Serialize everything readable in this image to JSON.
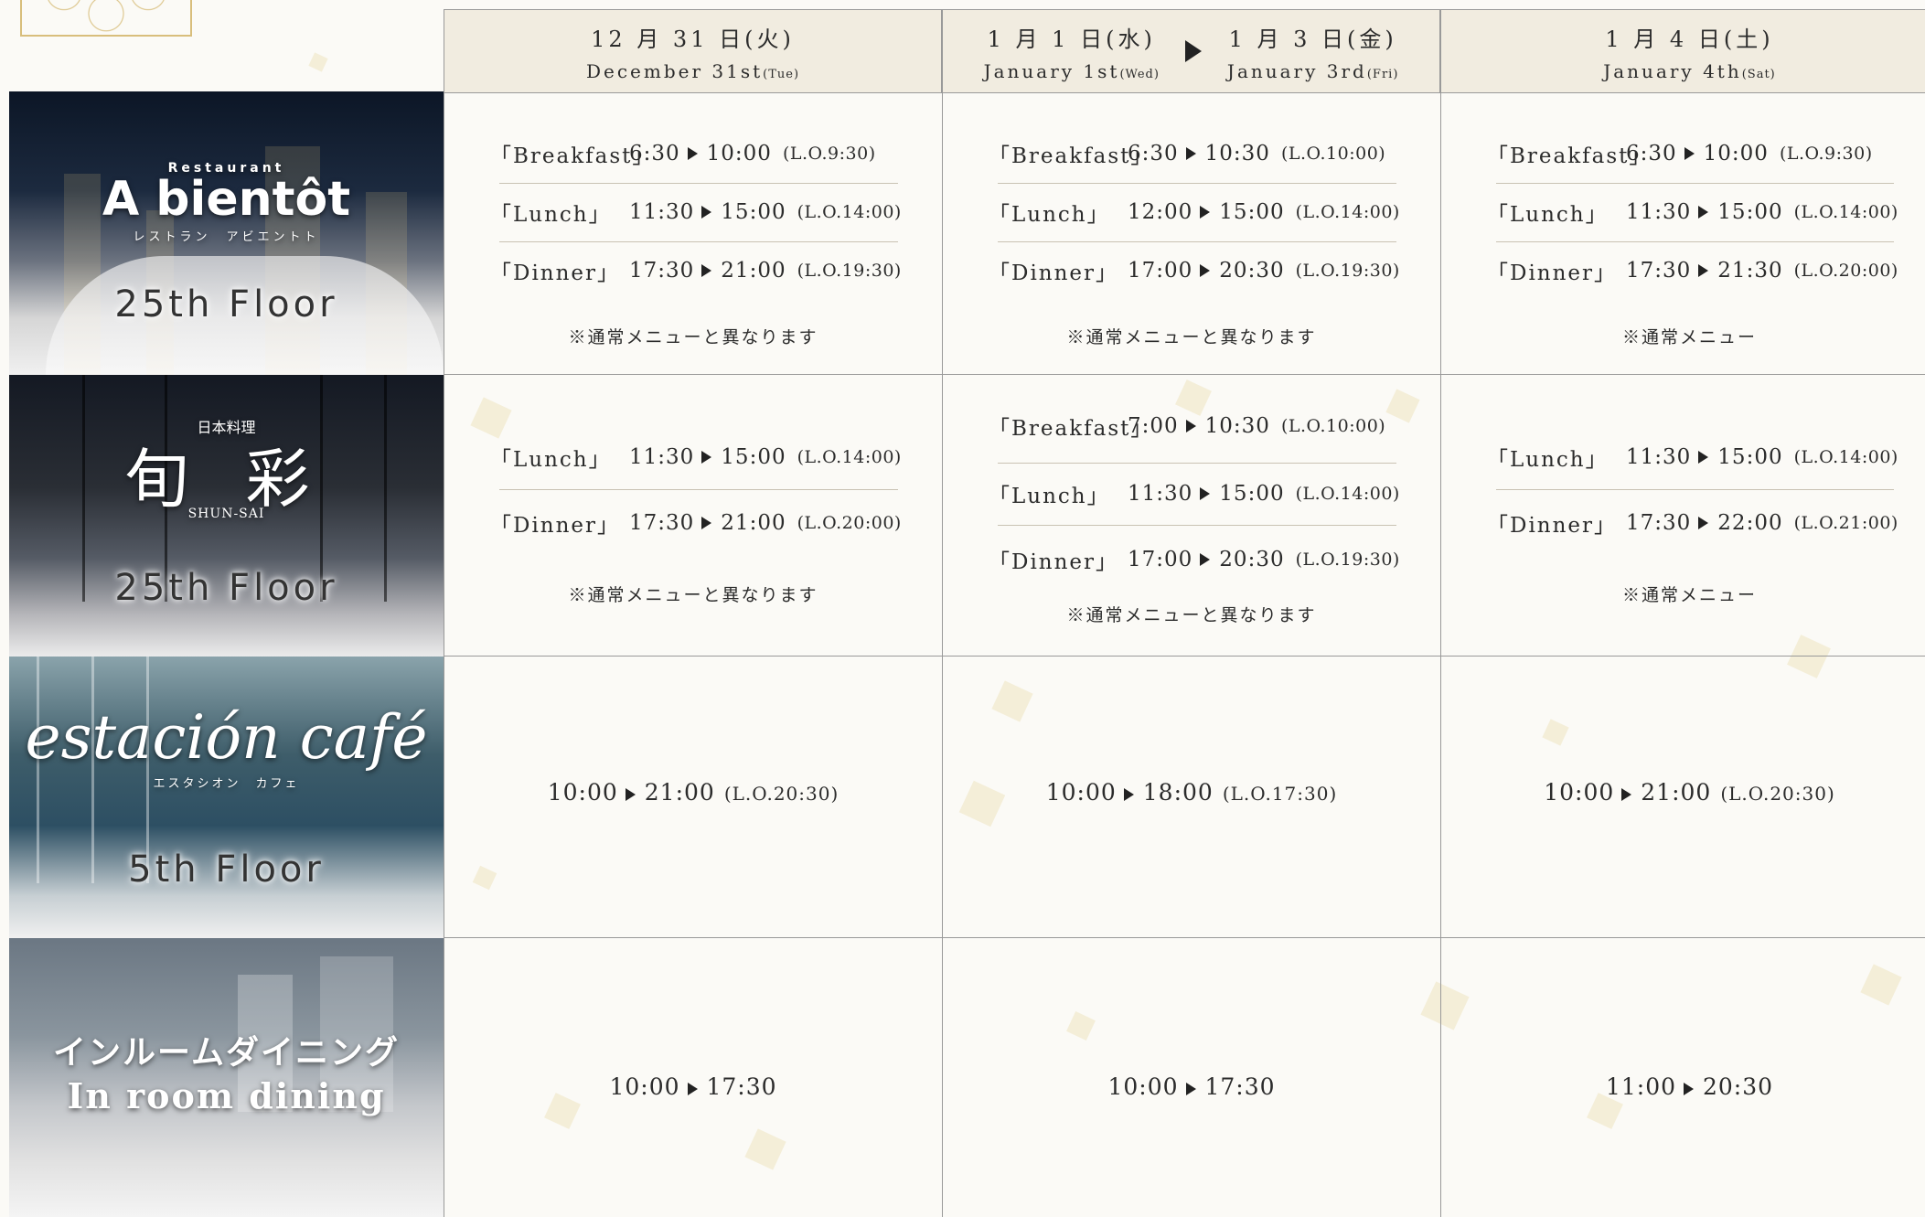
{
  "columns": [
    {
      "jp": "12 月 31 日",
      "jp_day": "(火)",
      "en": "December 31st",
      "en_day": "(Tue)"
    },
    {
      "jp_from": "1 月 1 日",
      "jp_from_day": "(水)",
      "en_from": "January 1st",
      "en_from_day": "(Wed)",
      "jp_to": "1 月 3 日",
      "jp_to_day": "(金)",
      "en_to": "January 3rd",
      "en_to_day": "(Fri)"
    },
    {
      "jp": "1 月 4 日",
      "jp_day": "(土)",
      "en": "January 4th",
      "en_day": "(Sat)"
    }
  ],
  "restaurants": [
    {
      "logo_small": "Restaurant",
      "logo": "A bientôt",
      "logo_kana": "レストラン　アビエントト",
      "floor": "25th Floor",
      "cells": [
        {
          "meals": [
            {
              "name": "「Breakfast」",
              "start": "6:30",
              "end": "10:00",
              "lo": "(L.O.9:30)"
            },
            {
              "name": "「Lunch」",
              "start": "11:30",
              "end": "15:00",
              "lo": "(L.O.14:00)"
            },
            {
              "name": "「Dinner」",
              "start": "17:30",
              "end": "21:00",
              "lo": "(L.O.19:30)"
            }
          ],
          "note": "※通常メニューと異なります"
        },
        {
          "meals": [
            {
              "name": "「Breakfast」",
              "start": "6:30",
              "end": "10:30",
              "lo": "(L.O.10:00)"
            },
            {
              "name": "「Lunch」",
              "start": "12:00",
              "end": "15:00",
              "lo": "(L.O.14:00)"
            },
            {
              "name": "「Dinner」",
              "start": "17:00",
              "end": "20:30",
              "lo": "(L.O.19:30)"
            }
          ],
          "note": "※通常メニューと異なります"
        },
        {
          "meals": [
            {
              "name": "「Breakfast」",
              "start": "6:30",
              "end": "10:00",
              "lo": "(L.O.9:30)"
            },
            {
              "name": "「Lunch」",
              "start": "11:30",
              "end": "15:00",
              "lo": "(L.O.14:00)"
            },
            {
              "name": "「Dinner」",
              "start": "17:30",
              "end": "21:30",
              "lo": "(L.O.20:00)"
            }
          ],
          "note": "※通常メニュー"
        }
      ]
    },
    {
      "logo_small": "日本料理",
      "logo": "旬 彩",
      "logo_kana": "SHUN-SAI",
      "floor": "25th Floor",
      "cells": [
        {
          "meals": [
            {
              "name": "「Lunch」",
              "start": "11:30",
              "end": "15:00",
              "lo": "(L.O.14:00)"
            },
            {
              "name": "「Dinner」",
              "start": "17:30",
              "end": "21:00",
              "lo": "(L.O.20:00)"
            }
          ],
          "note": "※通常メニューと異なります"
        },
        {
          "meals": [
            {
              "name": "「Breakfast」",
              "start": "7:00",
              "end": "10:30",
              "lo": "(L.O.10:00)"
            },
            {
              "name": "「Lunch」",
              "start": "11:30",
              "end": "15:00",
              "lo": "(L.O.14:00)"
            },
            {
              "name": "「Dinner」",
              "start": "17:00",
              "end": "20:30",
              "lo": "(L.O.19:30)"
            }
          ],
          "note": "※通常メニューと異なります"
        },
        {
          "meals": [
            {
              "name": "「Lunch」",
              "start": "11:30",
              "end": "15:00",
              "lo": "(L.O.14:00)"
            },
            {
              "name": "「Dinner」",
              "start": "17:30",
              "end": "22:00",
              "lo": "(L.O.21:00)"
            }
          ],
          "note": "※通常メニュー"
        }
      ]
    },
    {
      "logo": "estación café",
      "logo_kana": "エスタシオン　カフェ",
      "floor": "5th Floor",
      "cells": [
        {
          "start": "10:00",
          "end": "21:00",
          "lo": "(L.O.20:30)"
        },
        {
          "start": "10:00",
          "end": "18:00",
          "lo": "(L.O.17:30)"
        },
        {
          "start": "10:00",
          "end": "21:00",
          "lo": "(L.O.20:30)"
        }
      ]
    },
    {
      "logo": "インルームダイニング",
      "logo_en": "In room dining",
      "cells": [
        {
          "start": "10:00",
          "end": "17:30"
        },
        {
          "start": "10:00",
          "end": "17:30"
        },
        {
          "start": "11:00",
          "end": "20:30"
        }
      ]
    }
  ]
}
